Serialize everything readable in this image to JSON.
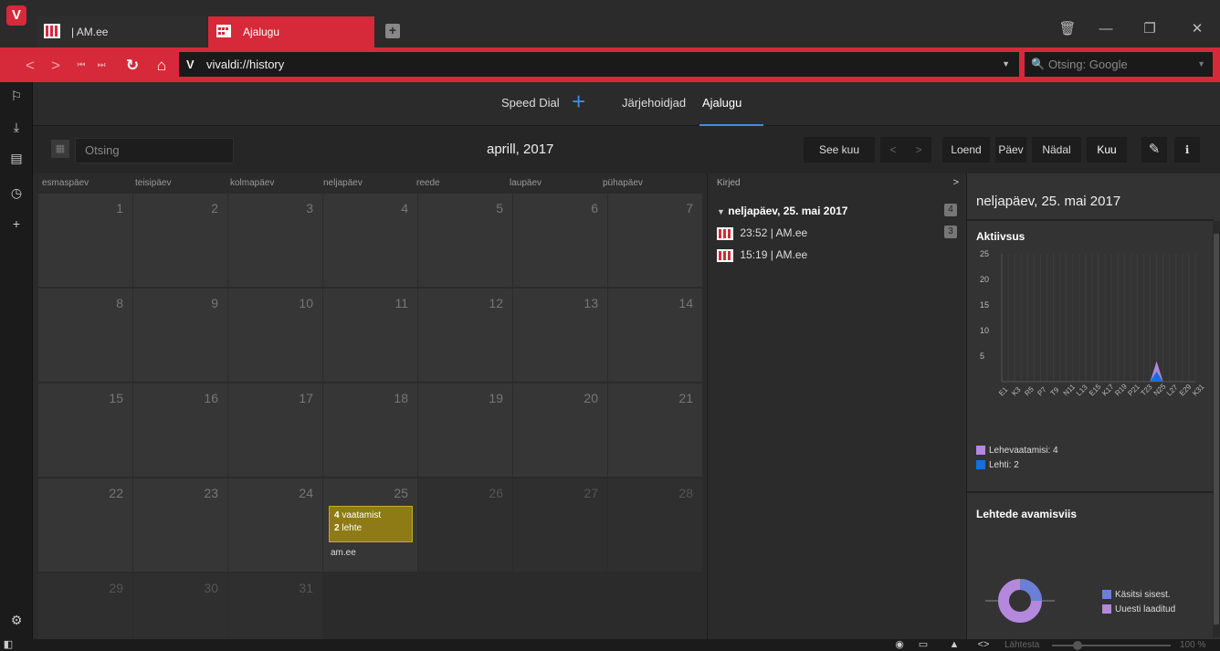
{
  "tabs": [
    {
      "label": "| AM.ee"
    },
    {
      "label": "Ajalugu"
    }
  ],
  "address": {
    "url": "vivaldi://history",
    "search_placeholder": "Otsing: Google"
  },
  "subnav": {
    "speed_dial": "Speed Dial",
    "bookmarks": "Järjehoidjad",
    "history": "Ajalugu"
  },
  "toolbar": {
    "search_placeholder": "Otsing",
    "month_title": "aprill, 2017",
    "this_month": "See kuu",
    "list": "Loend",
    "day": "Päev",
    "week": "Nädal",
    "month": "Kuu"
  },
  "calendar": {
    "weekdays": [
      "esmaspäev",
      "teisipäev",
      "kolmapäev",
      "neljapäev",
      "reede",
      "laupäev",
      "pühapäev"
    ],
    "days": [
      "1",
      "2",
      "3",
      "4",
      "5",
      "6",
      "7",
      "8",
      "9",
      "10",
      "11",
      "12",
      "13",
      "14",
      "15",
      "16",
      "17",
      "18",
      "19",
      "20",
      "21",
      "22",
      "23",
      "24",
      "25",
      "26",
      "27",
      "28",
      "29",
      "30",
      "31"
    ],
    "highlight": {
      "visits_count": "4",
      "visits_label": "vaatamist",
      "pages_count": "2",
      "pages_label": "lehte",
      "site": "am.ee"
    }
  },
  "entries": {
    "header": "Kirjed",
    "arrow": ">",
    "group_label": "neljapäev, 25. mai 2017",
    "group_count": "4",
    "items": [
      {
        "time_site": "23:52 | AM.ee",
        "count": "3"
      },
      {
        "time_site": "15:19 | AM.ee"
      }
    ]
  },
  "stats": {
    "title": "neljapäev, 25. mai 2017",
    "activity_title": "Aktiivsus",
    "y_ticks": [
      "25",
      "20",
      "15",
      "10",
      "5"
    ],
    "x_ticks": [
      "E1",
      "K3",
      "R5",
      "P7",
      "T9",
      "N11",
      "L13",
      "E15",
      "K17",
      "R19",
      "P21",
      "T23",
      "N25",
      "L27",
      "E29",
      "K31"
    ],
    "legend_views": "Lehevaatamisi: 4",
    "legend_pages": "Lehti: 2",
    "open_title": "Lehtede avamisviis",
    "legend_manual": "Käsitsi sisest.",
    "legend_reloaded": "Uuesti laaditud",
    "color_views": "#b388dd",
    "color_pages": "#1a6fd6"
  },
  "statusbar": {
    "reset": "Lähtesta",
    "zoom": "100 %"
  }
}
